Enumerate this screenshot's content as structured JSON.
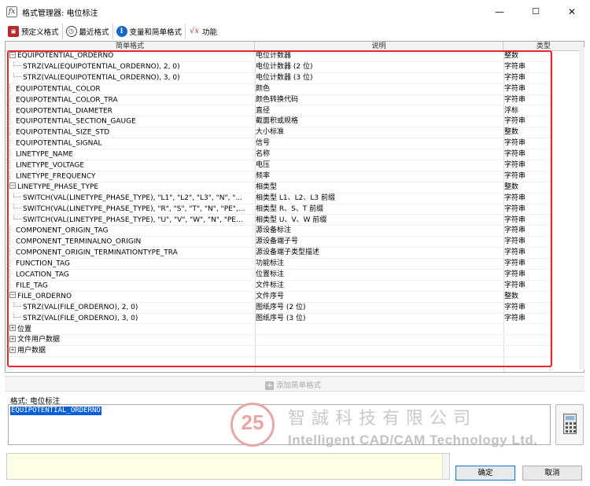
{
  "window": {
    "title": "格式管理器: 电位标注",
    "minimize": "—",
    "maximize": "☐",
    "close": "✕"
  },
  "tabs": [
    {
      "label": "预定义格式",
      "icon": "book-icon"
    },
    {
      "label": "最近格式",
      "icon": "clock-icon"
    },
    {
      "label": "变量和简单格式",
      "icon": "info-icon"
    },
    {
      "label": "功能",
      "icon": "function-icon"
    }
  ],
  "grid": {
    "headers": [
      "简单格式",
      "说明",
      "类型"
    ],
    "rows": [
      {
        "c1": "EQUIPOTENTIAL_ORDERNO",
        "c2": "电位计数器",
        "c3": "整数",
        "level": 0,
        "expander": "−"
      },
      {
        "c1": "STRZ(VAL(EQUIPOTENTIAL_ORDERNO), 2, 0)",
        "c2": "电位计数器 (2 位)",
        "c3": "字符串",
        "level": 1
      },
      {
        "c1": "STRZ(VAL(EQUIPOTENTIAL_ORDERNO), 3, 0)",
        "c2": "电位计数器 (3 位)",
        "c3": "字符串",
        "level": 1
      },
      {
        "c1": "EQUIPOTENTIAL_COLOR",
        "c2": "颜色",
        "c3": "字符串",
        "level": 0
      },
      {
        "c1": "EQUIPOTENTIAL_COLOR_TRA",
        "c2": "颜色转换代码",
        "c3": "字符串",
        "level": 0
      },
      {
        "c1": "EQUIPOTENTIAL_DIAMETER",
        "c2": "直径",
        "c3": "浮标",
        "level": 0
      },
      {
        "c1": "EQUIPOTENTIAL_SECTION_GAUGE",
        "c2": "截面积或规格",
        "c3": "字符串",
        "level": 0
      },
      {
        "c1": "EQUIPOTENTIAL_SIZE_STD",
        "c2": "大小标准",
        "c3": "整数",
        "level": 0
      },
      {
        "c1": "EQUIPOTENTIAL_SIGNAL",
        "c2": "信号",
        "c3": "字符串",
        "level": 0
      },
      {
        "c1": "LINETYPE_NAME",
        "c2": "名称",
        "c3": "字符串",
        "level": 0
      },
      {
        "c1": "LINETYPE_VOLTAGE",
        "c2": "电压",
        "c3": "字符串",
        "level": 0
      },
      {
        "c1": "LINETYPE_FREQUENCY",
        "c2": "频率",
        "c3": "字符串",
        "level": 0
      },
      {
        "c1": "LINETYPE_PHASE_TYPE",
        "c2": "相类型",
        "c3": "整数",
        "level": 0,
        "expander": "−"
      },
      {
        "c1": "SWITCH(VAL(LINETYPE_PHASE_TYPE), \"L1\", \"L2\", \"L3\", \"N\", \"...",
        "c2": "相类型 L1、L2、L3 前缀",
        "c3": "字符串",
        "level": 1
      },
      {
        "c1": "SWITCH(VAL(LINETYPE_PHASE_TYPE), \"R\", \"S\", \"T\", \"N\", \"PE\",...",
        "c2": "相类型 R、S、T 前缀",
        "c3": "字符串",
        "level": 1
      },
      {
        "c1": "SWITCH(VAL(LINETYPE_PHASE_TYPE), \"U\", \"V\", \"W\", \"N\", \"PE...",
        "c2": "相类型 U、V、W 前缀",
        "c3": "字符串",
        "level": 1
      },
      {
        "c1": "COMPONENT_ORIGIN_TAG",
        "c2": "源设备标注",
        "c3": "字符串",
        "level": 0
      },
      {
        "c1": "COMPONENT_TERMINALNO_ORIGIN",
        "c2": "源设备端子号",
        "c3": "字符串",
        "level": 0
      },
      {
        "c1": "COMPONENT_ORIGIN_TERMINATIONTYPE_TRA",
        "c2": "源设备端子类型描述",
        "c3": "字符串",
        "level": 0
      },
      {
        "c1": "FUNCTION_TAG",
        "c2": "功能标注",
        "c3": "字符串",
        "level": 0
      },
      {
        "c1": "LOCATION_TAG",
        "c2": "位置标注",
        "c3": "字符串",
        "level": 0
      },
      {
        "c1": "FILE_TAG",
        "c2": "文件标注",
        "c3": "字符串",
        "level": 0
      },
      {
        "c1": "FILE_ORDERNO",
        "c2": "文件序号",
        "c3": "整数",
        "level": 0,
        "expander": "−"
      },
      {
        "c1": "STRZ(VAL(FILE_ORDERNO), 2, 0)",
        "c2": "图纸序号 (2 位)",
        "c3": "字符串",
        "level": 1
      },
      {
        "c1": "STRZ(VAL(FILE_ORDERNO), 3, 0)",
        "c2": "图纸序号 (3 位)",
        "c3": "字符串",
        "level": 1
      },
      {
        "c1": "位置",
        "c2": "",
        "c3": "",
        "level": 0,
        "expander": "+"
      },
      {
        "c1": "文件用户数据",
        "c2": "",
        "c3": "",
        "level": 0,
        "expander": "+"
      },
      {
        "c1": "用户数据",
        "c2": "",
        "c3": "",
        "level": 0,
        "expander": "+"
      }
    ]
  },
  "add_button_label": "添加简单格式",
  "format": {
    "label": "格式: 电位标注",
    "value": "EQUIPOTENTIAL_ORDERNO"
  },
  "watermark": {
    "number": "25",
    "cn": "智誠科技有限公司",
    "en": "Intelligent CAD/CAM Technology Ltd."
  },
  "buttons": {
    "ok": "确定",
    "cancel": "取消"
  },
  "colors": {
    "highlight_border": "#e8262e",
    "selection": "#0b5fd6"
  }
}
